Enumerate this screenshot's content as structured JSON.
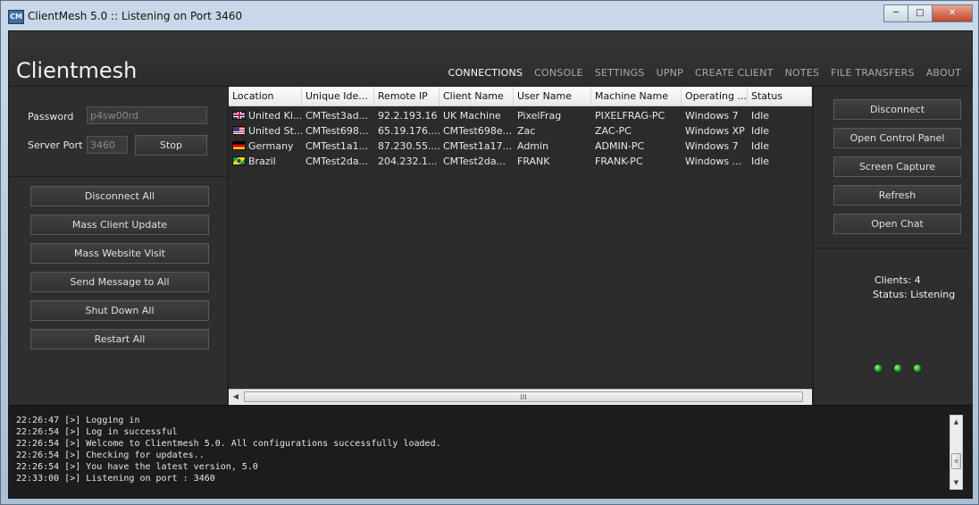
{
  "window": {
    "title": "ClientMesh 5.0 :: Listening on Port 3460",
    "icon_text": "CM",
    "buttons": [
      "minimize-icon",
      "maximize-icon",
      "close-icon"
    ]
  },
  "header": {
    "brand": "Clientmesh",
    "nav": [
      "CONNECTIONS",
      "CONSOLE",
      "SETTINGS",
      "UPNP",
      "CREATE CLIENT",
      "NOTES",
      "FILE TRANSFERS",
      "ABOUT"
    ],
    "active_nav": "CONNECTIONS"
  },
  "left": {
    "password_label": "Password",
    "password_value": "p4sw00rd",
    "port_label": "Server Port",
    "port_value": "3460",
    "stop_label": "Stop",
    "actions": [
      "Disconnect All",
      "Mass Client Update",
      "Mass Website Visit",
      "Send Message to All",
      "Shut Down All",
      "Restart All"
    ]
  },
  "table": {
    "columns": [
      "Location",
      "Unique Ide...",
      "Remote IP",
      "Client Name",
      "User Name",
      "Machine Name",
      "Operating ...",
      "Status"
    ],
    "rows": [
      {
        "flag": "uk-flag-icon",
        "cells": [
          "United Ki...",
          "CMTest3ad...",
          "92.2.193.16",
          "UK Machine",
          "PixelFrag",
          "PIXELFRAG-PC",
          "Windows 7",
          "Idle"
        ]
      },
      {
        "flag": "us-flag-icon",
        "cells": [
          "United St...",
          "CMTest698...",
          "65.19.176....",
          "CMTest698e...",
          "Zac",
          "ZAC-PC",
          "Windows XP",
          "Idle"
        ]
      },
      {
        "flag": "germany-flag-icon",
        "cells": [
          "Germany",
          "CMTest1a1...",
          "87.230.55....",
          "CMTest1a17...",
          "Admin",
          "ADMIN-PC",
          "Windows 7",
          "Idle"
        ]
      },
      {
        "flag": "brazil-flag-icon",
        "cells": [
          "Brazil",
          "CMTest2da...",
          "204.232.1...",
          "CMTest2da...",
          "FRANK",
          "FRANK-PC",
          "Windows ...",
          "Idle"
        ]
      }
    ],
    "scroll_grip": "III"
  },
  "right": {
    "actions": [
      "Disconnect",
      "Open Control Panel",
      "Screen Capture",
      "Refresh",
      "Open Chat"
    ],
    "clients_text": "Clients: 4",
    "status_text": "Status: Listening",
    "indicator_color": "#22c222"
  },
  "log": [
    "22:26:47 [>] Logging in",
    "22:26:54 [>] Log in successful",
    "22:26:54 [>] Welcome to Clientmesh 5.0. All configurations successfully loaded.",
    "22:26:54 [>] Checking for updates..",
    "22:26:54 [>] You have the latest version, 5.0",
    "22:33:00 [>] Listening on port : 3460"
  ]
}
